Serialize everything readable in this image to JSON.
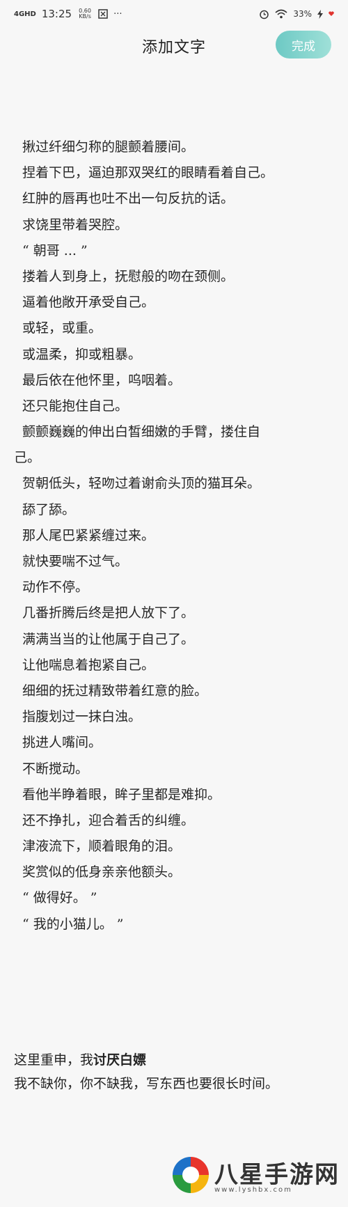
{
  "status_bar": {
    "network_type": "4GHD",
    "time": "13:25",
    "speed_value": "0.60",
    "speed_unit": "KB/s",
    "more_dots": "···",
    "battery_percent": "33%"
  },
  "header": {
    "title": "添加文字",
    "done_label": "完成"
  },
  "editor": {
    "lines": [
      "揪过纤细匀称的腿颤着腰间。",
      "捏着下巴，逼迫那双哭红的眼睛看着自己。",
      "红肿的唇再也吐不出一句反抗的话。",
      "求饶里带着哭腔。",
      "“ 朝哥 ... ”",
      "搂着人到身上，抚慰般的吻在颈侧。",
      "逼着他敞开承受自己。",
      "或轻，或重。",
      "或温柔，抑或粗暴。",
      "最后依在他怀里，呜咽着。",
      "还只能抱住自己。",
      "颤颤巍巍的伸出白皙细嫩的手臂，搂住自",
      "己。",
      "贺朝低头，轻吻过着谢俞头顶的猫耳朵。",
      "舔了舔。",
      "那人尾巴紧紧缠过来。",
      "就快要喘不过气。",
      "动作不停。",
      "几番折腾后终是把人放下了。",
      "满满当当的让他属于自己了。",
      "让他喘息着抱紧自己。",
      "细细的抚过精致带着红意的脸。",
      "指腹划过一抹白浊。",
      "挑进人嘴间。",
      "不断搅动。",
      "看他半睁着眼，眸子里都是难抑。",
      "还不挣扎，迎合着舌的纠缠。",
      "津液流下，顺着眼角的泪。",
      "奖赏似的低身亲亲他额头。",
      "“ 做得好。 ”",
      "“ 我的小猫儿。 ”"
    ],
    "continuation_index": 12
  },
  "footer_note": {
    "line1_prefix": "这里重申，我",
    "line1_bold": "讨厌白嫖",
    "line2": "我不缺你，你不缺我，写东西也要很长时间。"
  },
  "watermark": {
    "text": "八星手游网",
    "url": "www.lyshbx.com"
  },
  "colors": {
    "done_button_start": "#6dc9c4",
    "done_button_end": "#9fe0d8",
    "background": "#f7f7f7"
  }
}
